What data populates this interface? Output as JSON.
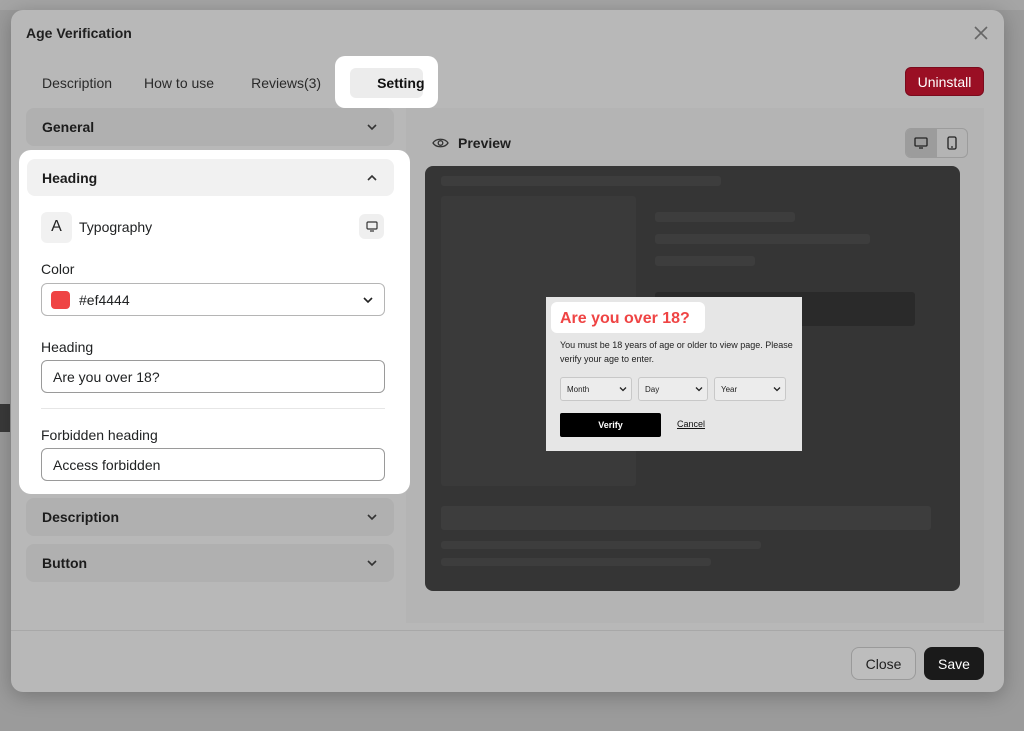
{
  "modal": {
    "title": "Age Verification"
  },
  "tabs": [
    {
      "label": "Description"
    },
    {
      "label": "How to use"
    },
    {
      "label": "Reviews(3)"
    },
    {
      "label": "Setting"
    }
  ],
  "uninstall_label": "Uninstall",
  "sections": {
    "general": "General",
    "heading": "Heading",
    "description": "Description",
    "button": "Button"
  },
  "heading_settings": {
    "typography_icon_letter": "A",
    "typography_label": "Typography",
    "color_label": "Color",
    "color_value": "#ef4444",
    "heading_label": "Heading",
    "heading_value": "Are you over 18?",
    "forbidden_label": "Forbidden heading",
    "forbidden_value": "Access forbidden"
  },
  "preview": {
    "title": "Preview",
    "popup": {
      "heading": "Are you over 18?",
      "text": "You must be 18 years of age or older to view page. Please verify your age to enter.",
      "month": "Month",
      "day": "Day",
      "year": "Year",
      "verify": "Verify",
      "cancel": "Cancel"
    }
  },
  "footer": {
    "close": "Close",
    "save": "Save"
  },
  "colors": {
    "accent": "#ef4444",
    "uninstall": "#9a0f24",
    "save": "#1a1a1a"
  }
}
